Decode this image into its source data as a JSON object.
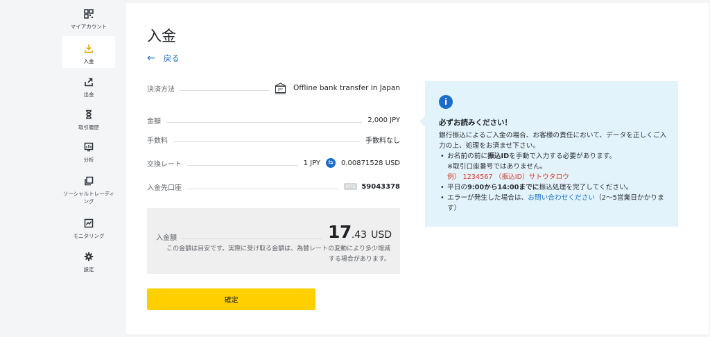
{
  "sidebar": {
    "items": [
      {
        "label": "マイアカウント",
        "icon": "grid-icon"
      },
      {
        "label": "入金",
        "icon": "download-icon"
      },
      {
        "label": "出金",
        "icon": "upload-icon"
      },
      {
        "label": "取引履歴",
        "icon": "hourglass-icon"
      },
      {
        "label": "分析",
        "icon": "analytics-icon"
      },
      {
        "label": "ソーシャルトレーディング",
        "icon": "copy-icon"
      },
      {
        "label": "モニタリング",
        "icon": "monitoring-icon"
      },
      {
        "label": "設定",
        "icon": "gear-icon"
      }
    ],
    "active": "入金"
  },
  "page": {
    "title": "入金",
    "back_label": "戻る"
  },
  "details": {
    "payment_method_label": "決済方法",
    "payment_method_value": "Offline bank transfer in Japan",
    "bank_icon_text": "JPY",
    "amount_label": "金額",
    "amount_value": "2,000 JPY",
    "fee_label": "手数料",
    "fee_value": "手数料なし",
    "rate_label": "交換レート",
    "rate_from": "1 JPY",
    "rate_to": "0.00871528 USD",
    "account_label": "入金先口座",
    "account_badge": "MT5",
    "account_value": "59043378"
  },
  "summary": {
    "label": "入金額",
    "amount_int": "17",
    "amount_dec": ".43",
    "currency": "USD",
    "note": "この金額は目安です。実際に受け取る金額は、為替レートの変動により多少増減する場合があります。"
  },
  "confirm_label": "確定",
  "info": {
    "heading": "必ずお読みください！",
    "intro": "銀行振込によるご入金の場合、お客様の責任において、データを正しくご入力の上、処理をお済ませ下さい。",
    "b1_pre": "お名前の前に",
    "b1_bold": "振込ID",
    "b1_post": "を手動で入力する必要があります。",
    "b1_note": "※取引口座番号ではありません。",
    "b1_example": "例） 1234567 （振込ID）サトウタロウ",
    "b2_pre": "平日の",
    "b2_bold1": "9:00",
    "b2_mid1": "から",
    "b2_bold2": "14:00",
    "b2_mid2": "までに",
    "b2_post": "振込処理を完了してください。",
    "b3_pre": "エラーが発生した場合は、",
    "b3_link": "お問い合わせください",
    "b3_post": "（2〜5営業日かかります）"
  },
  "colors": {
    "accent": "#1a6ec8",
    "button": "#ffcf00",
    "info_bg": "#e3f3fb",
    "warning_red": "#d43a2a"
  }
}
